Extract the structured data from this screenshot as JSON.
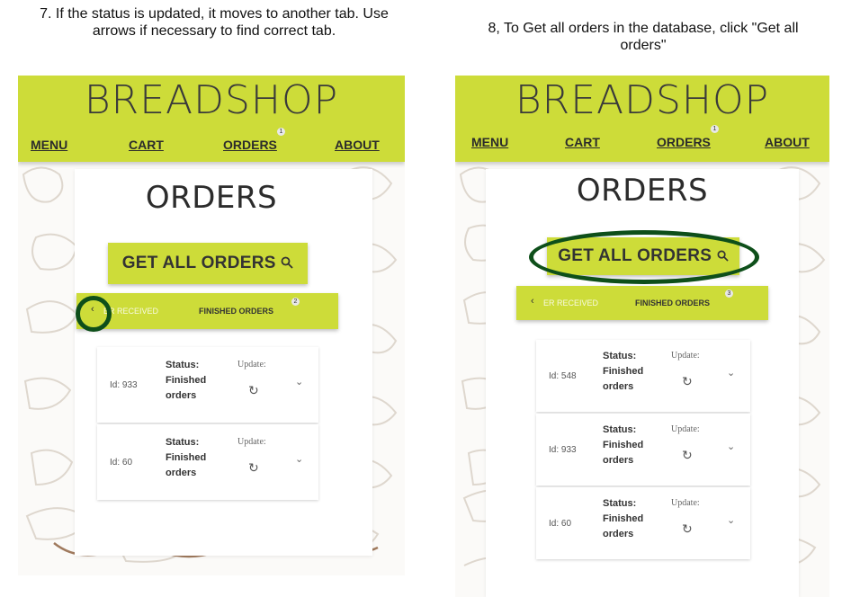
{
  "captions": {
    "left": "7. If the status is updated, it moves to another tab. Use arrows if necessary to find correct tab.",
    "right": "8, To Get all orders in the database, click \"Get all orders\""
  },
  "app": {
    "brand": "BREADSHOP",
    "nav": {
      "menu": "MENU",
      "cart": "CART",
      "orders": "ORDERS",
      "about": "ABOUT"
    },
    "page_title": "ORDERS",
    "get_all_label": "GET ALL ORDERS",
    "search_icon": "magnifier-icon",
    "prev_arrow": "‹",
    "tab_received": "ER RECEIVED",
    "tab_finished": "FINISHED ORDERS",
    "status_label": "Status:",
    "status_value_line1": "Finished",
    "status_value_line2": "orders",
    "update_label": "Update:",
    "refresh_icon": "refresh-icon",
    "chevron": "⌄",
    "accent_color": "#cddc39",
    "ring_color": "#0e4f1a"
  },
  "left": {
    "orders_badge": "1",
    "tab_badge": "2",
    "orders": [
      {
        "id_text": "Id: 933"
      },
      {
        "id_text": "Id: 60"
      }
    ]
  },
  "right": {
    "orders_badge": "1",
    "tab_badge": "3",
    "orders": [
      {
        "id_text": "Id: 548"
      },
      {
        "id_text": "Id: 933"
      },
      {
        "id_text": "Id: 60"
      }
    ]
  }
}
